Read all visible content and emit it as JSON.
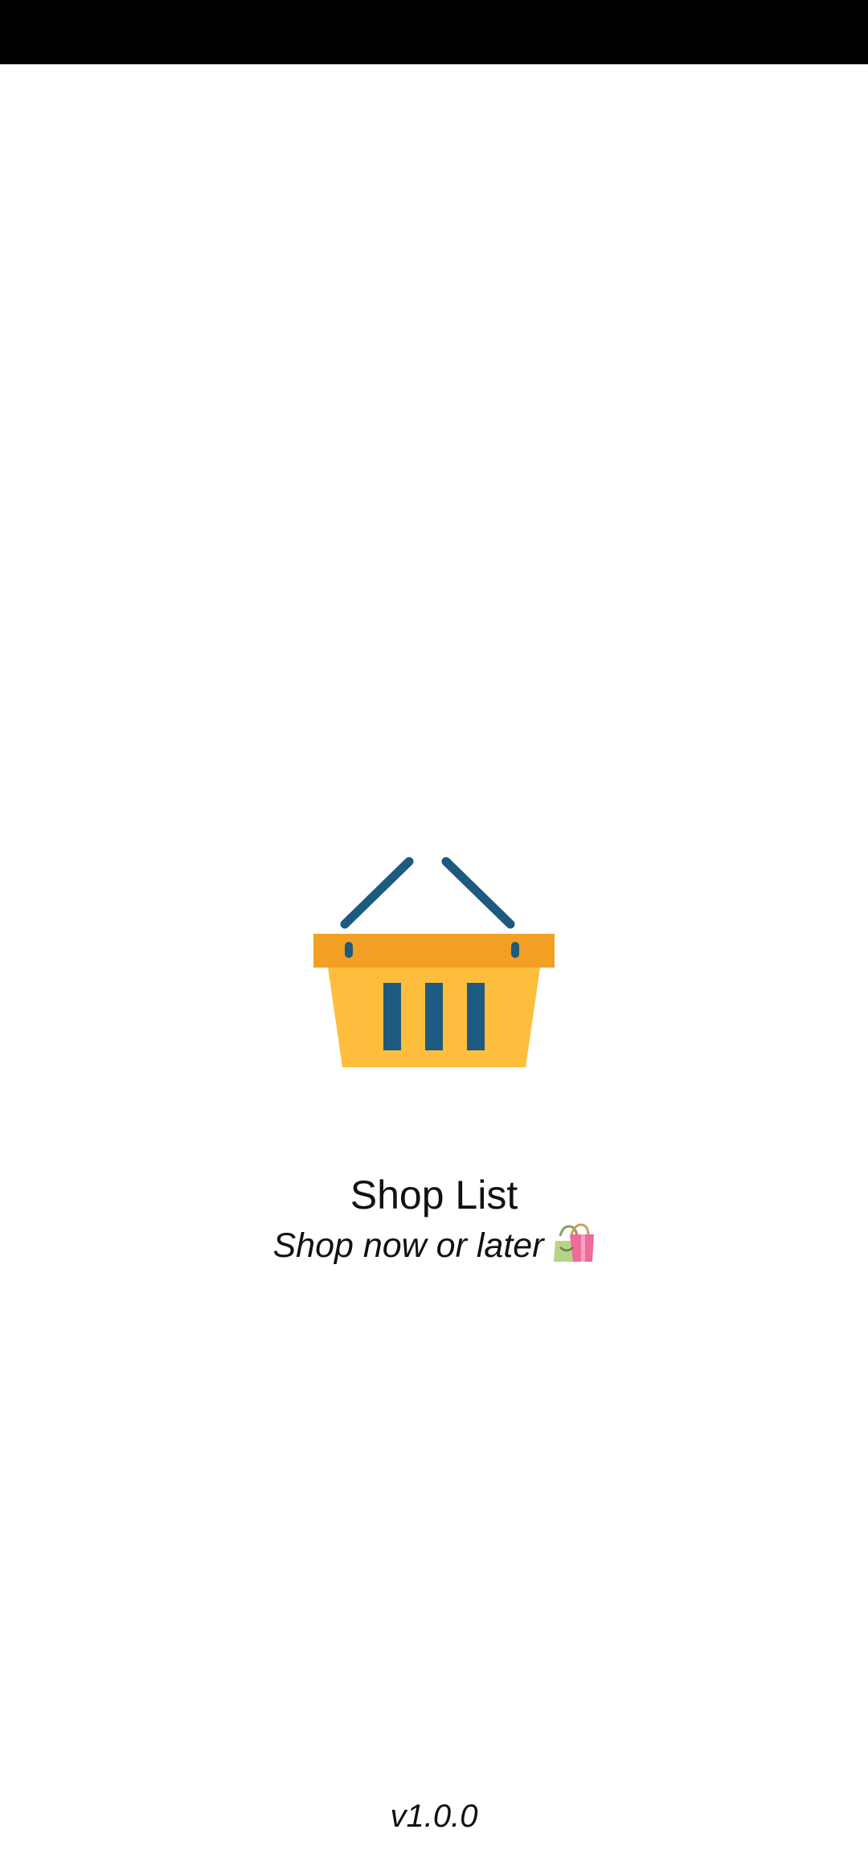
{
  "app": {
    "name": "Shop List",
    "tagline": "Shop now or later",
    "version": "v1.0.0"
  },
  "icons": {
    "logo": "shopping-basket-icon",
    "tagline_emoji": "shopping-bags-icon"
  },
  "colors": {
    "status_bar": "#000000",
    "background": "#ffffff",
    "basket_rim": "#F2A024",
    "basket_body": "#FDBE3E",
    "basket_handles": "#1D5A7F"
  }
}
